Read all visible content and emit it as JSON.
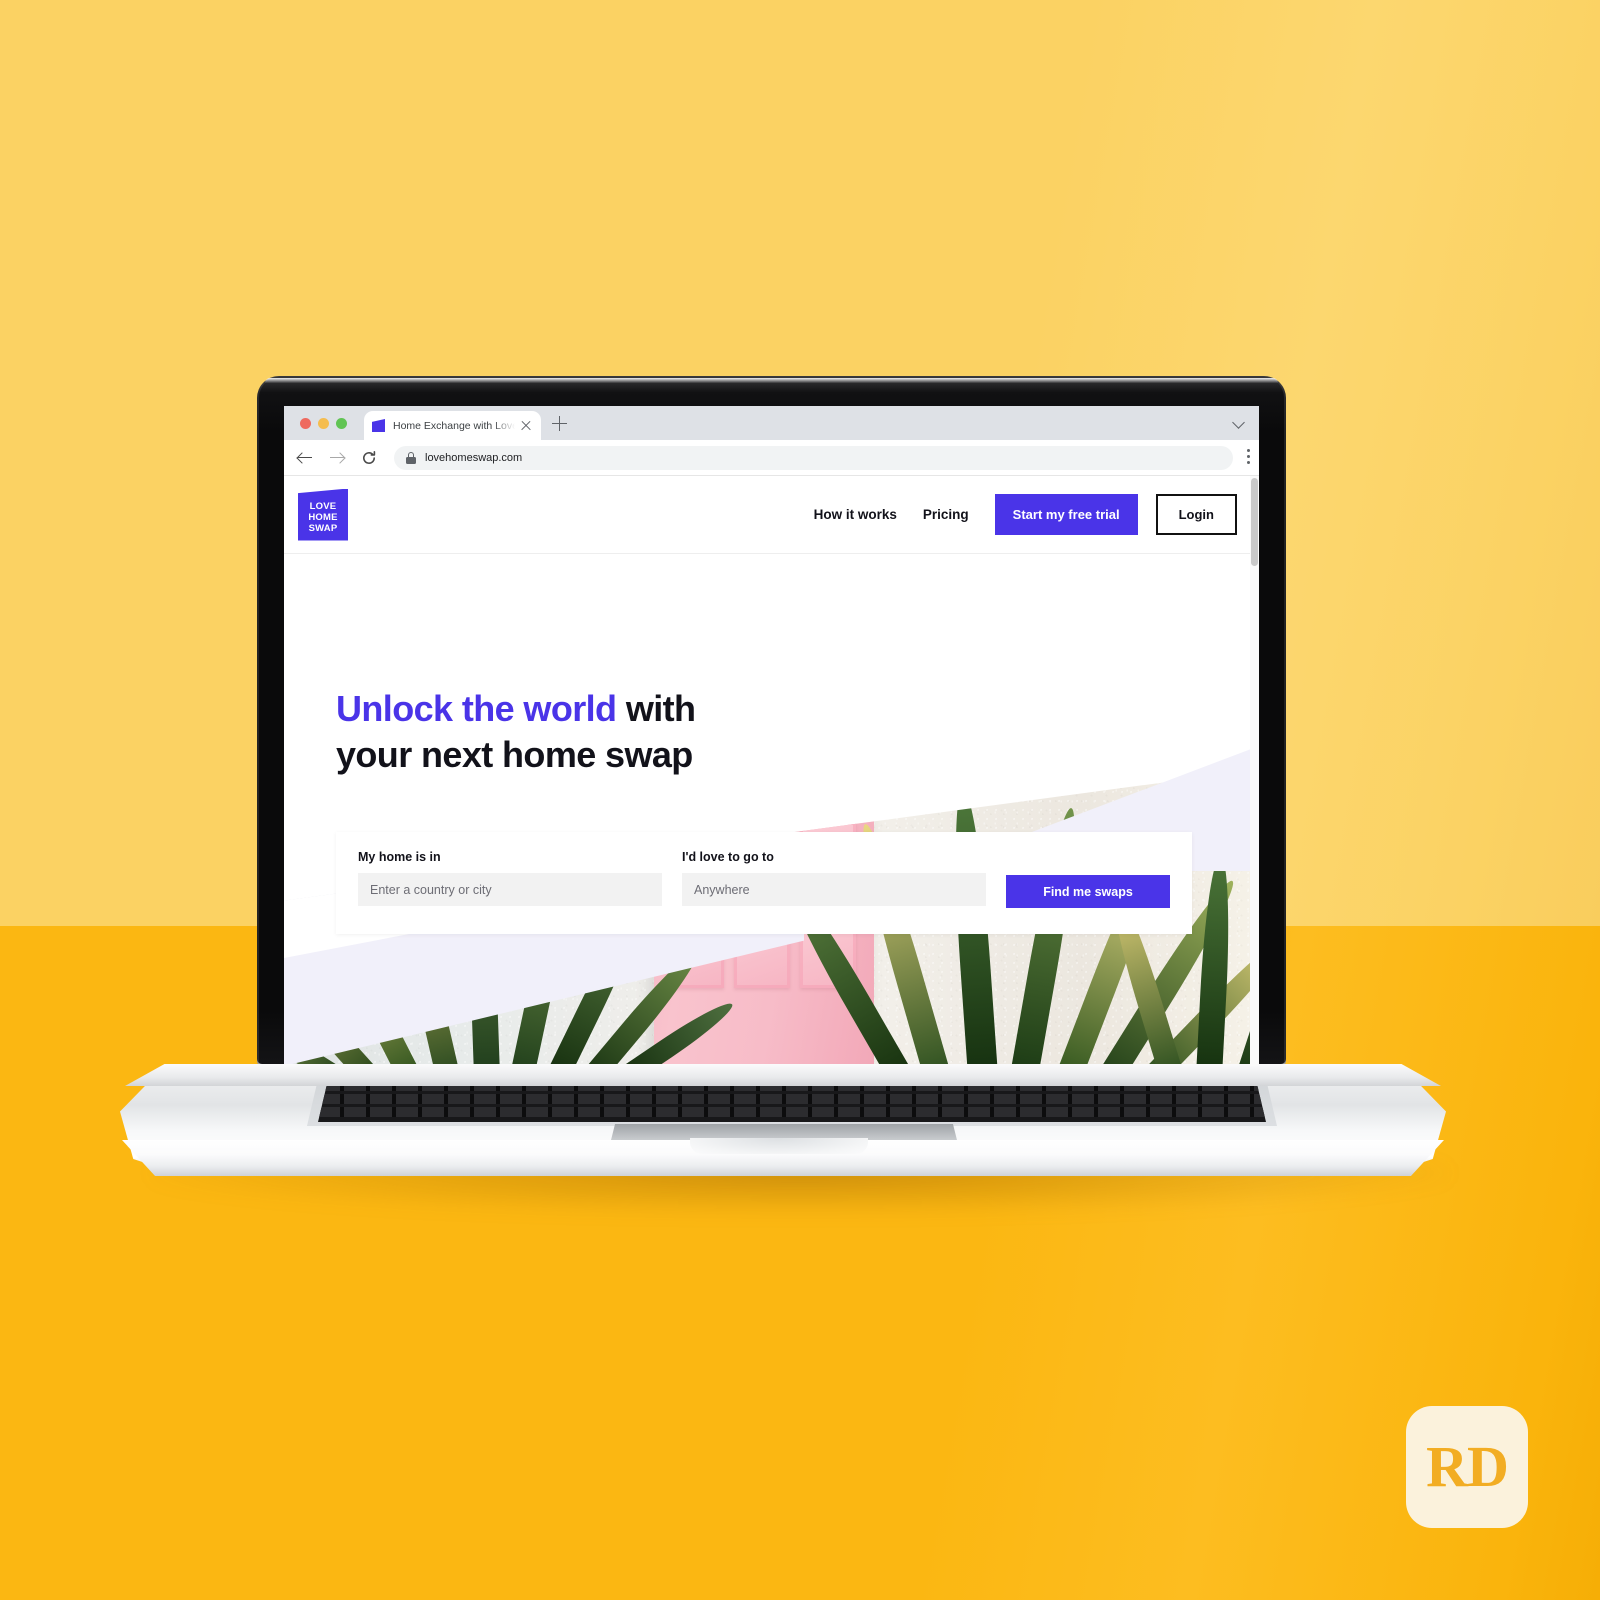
{
  "background": {
    "top_color": "#fbd263",
    "bottom_color": "#fbb712"
  },
  "browser": {
    "tab": {
      "title": "Home Exchange with Love Hom",
      "favicon": "lovehomeswap-favicon-icon",
      "close_icon": "close-icon"
    },
    "new_tab_icon": "plus-icon",
    "tab_list_icon": "chevron-down-icon",
    "toolbar": {
      "back_icon": "arrow-left-icon",
      "forward_icon": "arrow-right-icon",
      "reload_icon": "reload-icon",
      "lock_icon": "lock-icon",
      "url": "lovehomeswap.com",
      "menu_icon": "kebab-menu-icon"
    },
    "traffic_lights": [
      "close-red",
      "minimize-amber",
      "maximize-green"
    ]
  },
  "site": {
    "logo": {
      "line1": "LOVE",
      "line2": "HOME",
      "line3": "SWAP",
      "color": "#4a34e8"
    },
    "nav": [
      {
        "label": "How it works"
      },
      {
        "label": "Pricing"
      }
    ],
    "cta_primary": "Start my free trial",
    "cta_secondary": "Login",
    "accent_color": "#4a34e8",
    "hero": {
      "headline_accent": "Unlock the world",
      "headline_rest": " with",
      "headline_line2": "your next home swap",
      "image_description": "pink panelled front door flanked by agave and snake plants"
    },
    "search": {
      "from_label": "My home is in",
      "from_value": "",
      "from_placeholder": "Enter a country or city",
      "to_label": "I'd love to go to",
      "to_value": "",
      "to_placeholder": "Anywhere",
      "submit_label": "Find me swaps"
    }
  },
  "watermark": {
    "text": "RD",
    "bg_color": "#fbf2dc",
    "text_color": "#f2ad23"
  }
}
